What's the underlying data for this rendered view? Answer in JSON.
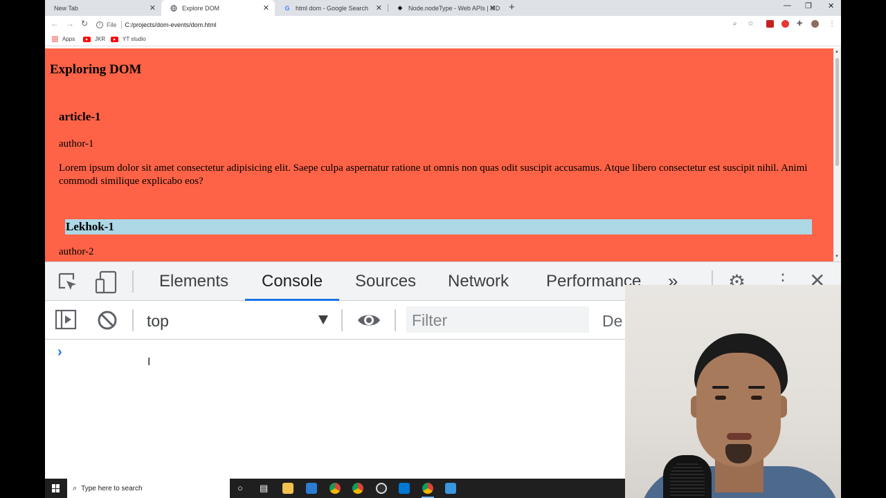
{
  "browser": {
    "tabs": [
      {
        "title": "New Tab",
        "icon": "none"
      },
      {
        "title": "Explore DOM",
        "icon": "globe-icon"
      },
      {
        "title": "html dom - Google Search",
        "icon": "google-icon"
      },
      {
        "title": "Node.nodeType - Web APIs | MD",
        "icon": "mdn-icon"
      }
    ],
    "address": {
      "scheme_label": "File",
      "url": "C:/projects/dom-events/dom.html"
    },
    "bookmarks": [
      {
        "label": "Apps",
        "icon": "apps-grid-icon"
      },
      {
        "label": "JKR",
        "icon": "youtube-icon"
      },
      {
        "label": "YT studio",
        "icon": "youtube-icon"
      }
    ]
  },
  "page": {
    "heading": "Exploring DOM",
    "article_title": "article-1",
    "author1": "author-1",
    "lorem": "Lorem ipsum dolor sit amet consectetur adipisicing elit. Saepe culpa aspernatur ratione ut omnis non quas odit suscipit accusamus. Atque libero consectetur est suscipit nihil. Animi commodi similique explicabo eos?",
    "lekhok": "Lekhok-1",
    "author2": "author-2",
    "colors": {
      "background": "#ff6347",
      "highlight": "#add8e6"
    }
  },
  "devtools": {
    "tabs": [
      "Elements",
      "Console",
      "Sources",
      "Network",
      "Performance"
    ],
    "active_tab": "Console",
    "context": "top",
    "filter_placeholder": "Filter",
    "levels_label": "De",
    "accent": "#1a73e8"
  },
  "taskbar": {
    "search_placeholder": "Type here to search"
  }
}
